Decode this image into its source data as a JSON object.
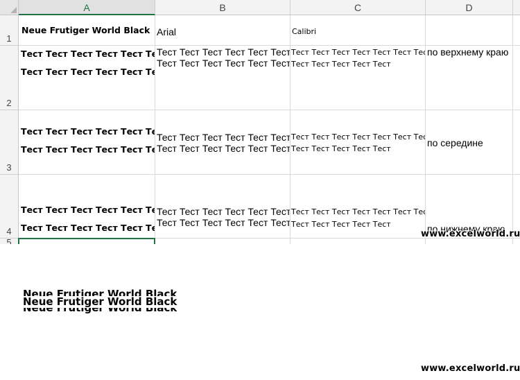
{
  "columns": [
    "A",
    "B",
    "C",
    "D"
  ],
  "rows": [
    "1",
    "2",
    "3",
    "4",
    "5"
  ],
  "cells": {
    "a1": "Neue Frutiger World Black",
    "b1": "Arial",
    "c1": "Calibri",
    "a_line": "Тест Тест Тест Тест Тест Тест",
    "b_line": "Тест Тест Тест Тест Тест Тест",
    "c_line1": "Тест Тест Тест Тест Тест Тест Тест",
    "c_line2": "Тест Тест Тест Тест Тест",
    "d2": "по верхнему краю",
    "d3": "по середине",
    "d4": "по нижнему краю"
  },
  "overlay": {
    "sample_text": "Neue Frutiger World Black",
    "watermark": "www.excelworld.ru"
  }
}
